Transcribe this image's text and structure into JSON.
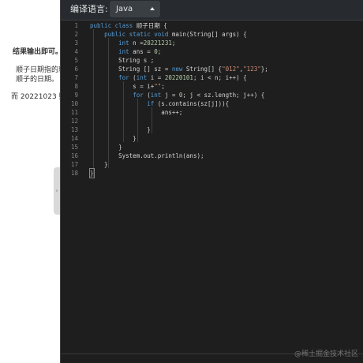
{
  "left_panel": {
    "lines": [
      "结果输出即可。",
      "顺子日期指的就",
      "顺子的日期。",
      "而 20221023 则"
    ]
  },
  "toolbar": {
    "language_label": "编译语言:",
    "language_value": "Java"
  },
  "code": {
    "line_numbers": [
      "1",
      "2",
      "3",
      "4",
      "5",
      "6",
      "7",
      "8",
      "9",
      "10",
      "11",
      "12",
      "13",
      "14",
      "15",
      "16",
      "17",
      "18"
    ]
  },
  "watermark": "@稀土掘金技术社区",
  "colors": {
    "keyword": "#569cd6",
    "number": "#b5cea8",
    "string": "#ce9178",
    "background": "#1e1e1e"
  }
}
